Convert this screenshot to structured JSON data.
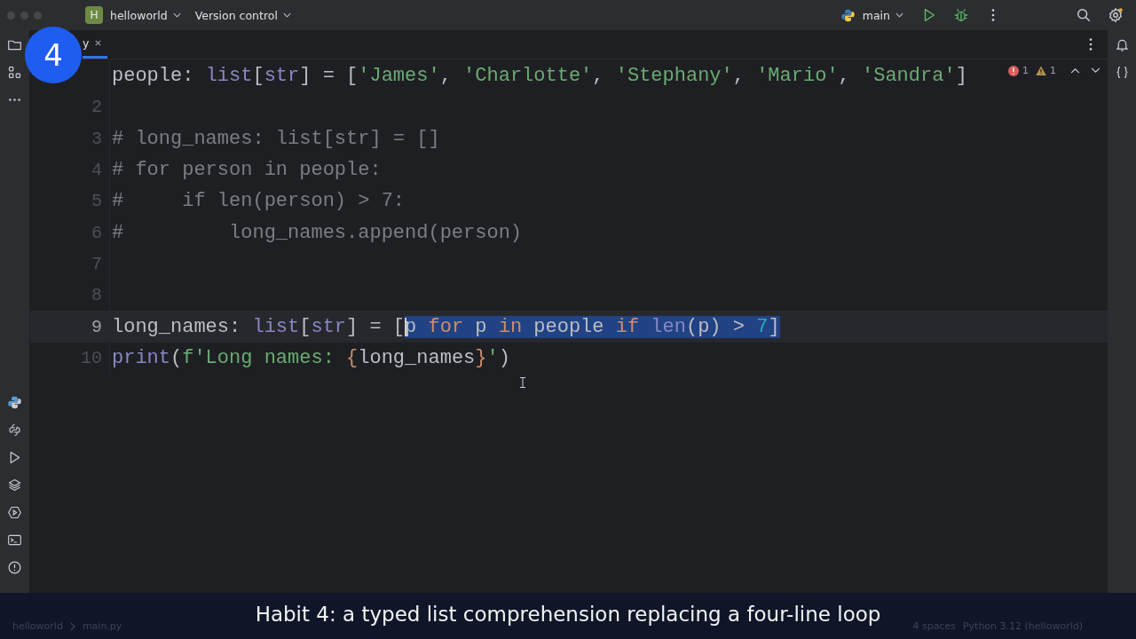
{
  "title_bar": {
    "project_badge": "H",
    "project": "helloworld",
    "vcs": "Version control",
    "run_config": "main"
  },
  "tab": {
    "label": "y",
    "selected": true
  },
  "inspections": {
    "errors": "1",
    "warnings": "1"
  },
  "editor": {
    "lines": [
      {
        "current": false,
        "tokens": [
          {
            "kind": "plain",
            "text": "people: "
          },
          {
            "kind": "type",
            "text": "list"
          },
          {
            "kind": "plain",
            "text": "["
          },
          {
            "kind": "type",
            "text": "str"
          },
          {
            "kind": "plain",
            "text": "] = ["
          },
          {
            "kind": "str",
            "text": "'James'"
          },
          {
            "kind": "plain",
            "text": ", "
          },
          {
            "kind": "str",
            "text": "'Charlotte'"
          },
          {
            "kind": "plain",
            "text": ", "
          },
          {
            "kind": "str",
            "text": "'Stephany'"
          },
          {
            "kind": "plain",
            "text": ", "
          },
          {
            "kind": "str",
            "text": "'Mario'"
          },
          {
            "kind": "plain",
            "text": ", "
          },
          {
            "kind": "str",
            "text": "'Sandra'"
          },
          {
            "kind": "plain",
            "text": "]"
          }
        ]
      },
      {
        "number": "2",
        "current": false
      },
      {
        "number": "3",
        "current": false,
        "tokens": [
          {
            "kind": "comment",
            "text": "# long_names: list[str] = []"
          }
        ]
      },
      {
        "number": "4",
        "current": false,
        "tokens": [
          {
            "kind": "comment",
            "text": "# for person in people:"
          }
        ]
      },
      {
        "number": "5",
        "current": false,
        "tokens": [
          {
            "kind": "comment",
            "text": "#     if len(person) > 7:"
          }
        ]
      },
      {
        "number": "6",
        "current": false,
        "tokens": [
          {
            "kind": "comment",
            "text": "#         long_names.append(person)"
          }
        ]
      },
      {
        "number": "7",
        "current": false
      },
      {
        "number": "8",
        "current": false
      },
      {
        "number": "9",
        "current": true,
        "tokens": [
          {
            "kind": "plain",
            "text": "long_names: "
          },
          {
            "kind": "type",
            "text": "list"
          },
          {
            "kind": "plain",
            "text": "["
          },
          {
            "kind": "type",
            "text": "str"
          },
          {
            "kind": "plain",
            "text": "] = ["
          }
        ],
        "selection": [
          {
            "kind": "plain",
            "text": "p "
          },
          {
            "kind": "kw",
            "text": "for"
          },
          {
            "kind": "plain",
            "text": " p "
          },
          {
            "kind": "kw",
            "text": "in"
          },
          {
            "kind": "plain",
            "text": " people "
          },
          {
            "kind": "kw",
            "text": "if "
          },
          {
            "kind": "builtin",
            "text": "len"
          },
          {
            "kind": "plain",
            "text": "(p) > "
          },
          {
            "kind": "num",
            "text": "7"
          },
          {
            "kind": "plain",
            "text": "]"
          }
        ]
      },
      {
        "number": "10",
        "current": false,
        "tokens": [
          {
            "kind": "builtin",
            "text": "print"
          },
          {
            "kind": "plain",
            "text": "("
          },
          {
            "kind": "str",
            "text": "f'Long names: "
          },
          {
            "kind": "kw",
            "text": "{"
          },
          {
            "kind": "plain",
            "text": "long_names"
          },
          {
            "kind": "kw",
            "text": "}"
          },
          {
            "kind": "str",
            "text": "'"
          },
          {
            "kind": "plain",
            "text": ")"
          }
        ]
      }
    ]
  },
  "status_bar": {
    "path": [
      "helloworld",
      "main.py"
    ],
    "indent": "4 spaces",
    "interpreter": "Python 3.12 (helloworld)"
  },
  "step_badge": "4",
  "caption": "Habit 4: a typed list comprehension replacing a four-line loop"
}
